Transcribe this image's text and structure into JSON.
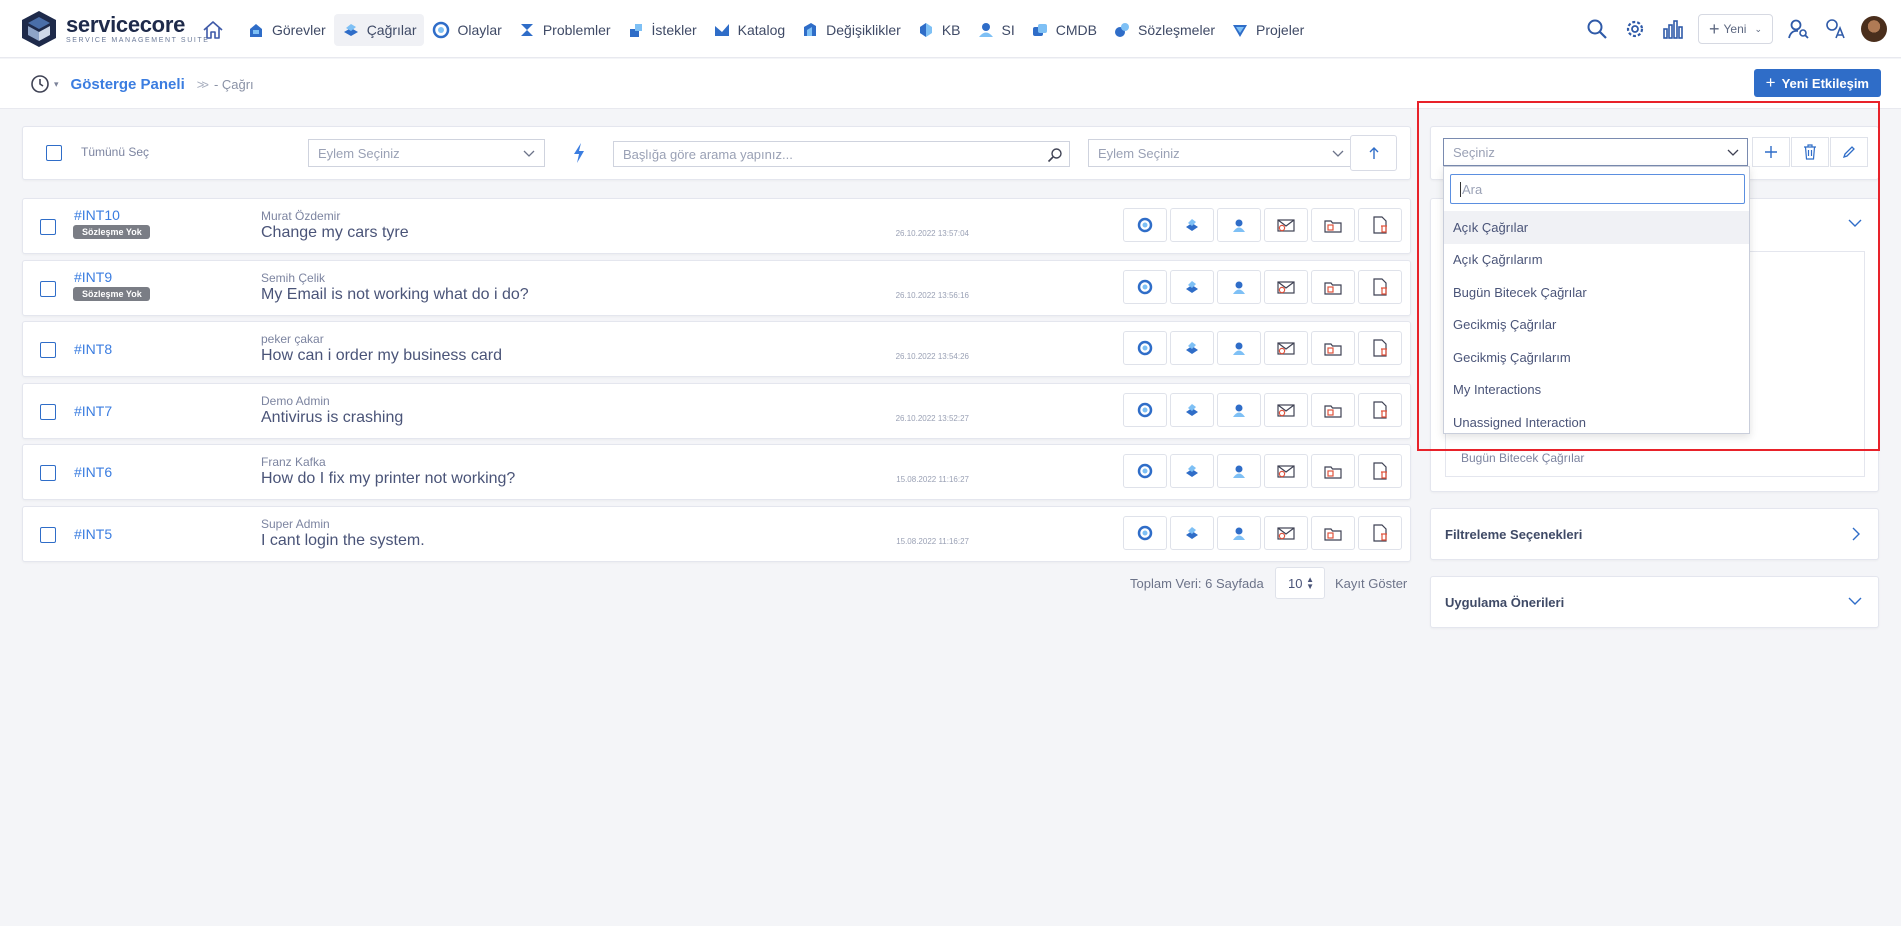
{
  "brand": {
    "name": "servicecore",
    "tagline": "SERVICE MANAGEMENT SUITE"
  },
  "colors": {
    "accent": "#2f6dc8",
    "link": "#3b7de0",
    "highlight": "#e8222a",
    "danger": "#e0533d"
  },
  "nav": [
    {
      "label": "Görevler",
      "icon": "tasks-icon"
    },
    {
      "label": "Çağrılar",
      "icon": "calls-icon",
      "active": true
    },
    {
      "label": "Olaylar",
      "icon": "incidents-icon"
    },
    {
      "label": "Problemler",
      "icon": "problems-icon"
    },
    {
      "label": "İstekler",
      "icon": "requests-icon"
    },
    {
      "label": "Katalog",
      "icon": "catalog-icon"
    },
    {
      "label": "Değişiklikler",
      "icon": "changes-icon"
    },
    {
      "label": "KB",
      "icon": "kb-icon"
    },
    {
      "label": "SI",
      "icon": "si-icon"
    },
    {
      "label": "CMDB",
      "icon": "cmdb-icon"
    },
    {
      "label": "Sözleşmeler",
      "icon": "contracts-icon"
    },
    {
      "label": "Projeler",
      "icon": "projects-icon"
    }
  ],
  "topbar": {
    "new_label": "Yeni"
  },
  "breadcrumb": {
    "root": "Gösterge Paneli",
    "current": "- Çağrı"
  },
  "new_interaction_label": "Yeni Etkileşim",
  "toolbar": {
    "select_all": "Tümünü Seç",
    "action_placeholder": "Eylem Seçiniz",
    "search_placeholder": "Başlığa göre arama yapınız...",
    "action_placeholder_2": "Eylem Seçiniz"
  },
  "rows": [
    {
      "id": "#INT10",
      "badge": "Sözleşme Yok",
      "owner": "Murat Özdemir",
      "title": "Change my cars tyre",
      "date": "26.10.2022 13:57:04"
    },
    {
      "id": "#INT9",
      "badge": "Sözleşme Yok",
      "owner": "Semih Çelik",
      "title": "My Email is not working what do i do?",
      "date": "26.10.2022 13:56:16"
    },
    {
      "id": "#INT8",
      "badge": "",
      "owner": "peker çakar",
      "title": "How can i order my business card",
      "date": "26.10.2022 13:54:26"
    },
    {
      "id": "#INT7",
      "badge": "",
      "owner": "Demo Admin",
      "title": "Antivirus is crashing",
      "date": "26.10.2022 13:52:27"
    },
    {
      "id": "#INT6",
      "badge": "",
      "owner": "Franz Kafka",
      "title": "How do I fix my printer not working?",
      "date": "15.08.2022 11:16:27"
    },
    {
      "id": "#INT5",
      "badge": "",
      "owner": "Super Admin",
      "title": "I cant login the system.",
      "date": "15.08.2022 11:16:27"
    }
  ],
  "pagination": {
    "total": "Toplam Veri: 6 Sayfada",
    "page_size": "10",
    "show_label": "Kayıt Göster"
  },
  "sidebar": {
    "filter_placeholder": "Seçiniz",
    "hint_text": "Bugün Bitecek Çağrılar",
    "filter_options_label": "Filtreleme Seçenekleri",
    "app_suggestions_label": "Uygulama Önerileri"
  },
  "dropdown": {
    "search_placeholder": "Ara",
    "options": [
      "Açık Çağrılar",
      "Açık Çağrılarım",
      "Bugün Bitecek Çağrılar",
      "Gecikmiş Çağrılar",
      "Gecikmiş Çağrılarım",
      "My Interactions",
      "Unassigned Interaction"
    ],
    "highlighted_index": 0
  }
}
